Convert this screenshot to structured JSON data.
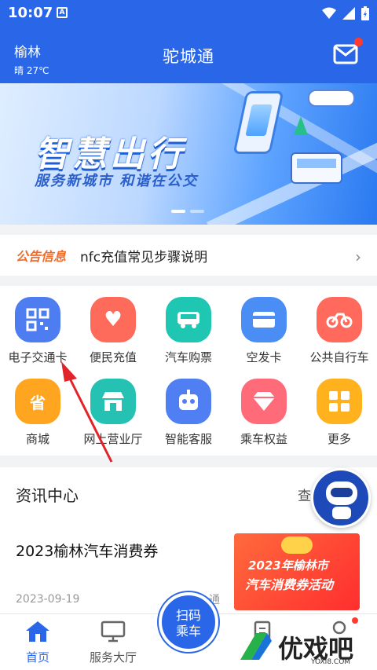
{
  "status_bar": {
    "time": "10:07",
    "badge": "A"
  },
  "header": {
    "city": "榆林",
    "weather": "晴 27℃",
    "title": "驼城通",
    "mail_icon": "mail-icon"
  },
  "banner": {
    "headline": "智慧出行",
    "subline": "服务新城市 和谐在公交"
  },
  "notice": {
    "tag": "公告信息",
    "text": "nfc充值常见步骤说明"
  },
  "services": [
    {
      "label": "电子交通卡",
      "icon": "qr-card-icon",
      "color": "#4d7df0"
    },
    {
      "label": "便民充值",
      "icon": "heart-hand-icon",
      "color": "#ff6b5a"
    },
    {
      "label": "汽车购票",
      "icon": "bus-icon",
      "color": "#1fc6b2"
    },
    {
      "label": "空发卡",
      "icon": "card-icon",
      "color": "#4a8ef5"
    },
    {
      "label": "公共自行车",
      "icon": "bike-icon",
      "color": "#ff6a5c"
    },
    {
      "label": "商城",
      "icon": "shop-bag-icon",
      "color": "#ffa51f"
    },
    {
      "label": "网上营业厅",
      "icon": "store-icon",
      "color": "#25c2b4"
    },
    {
      "label": "智能客服",
      "icon": "robot-icon",
      "color": "#4f7ff2"
    },
    {
      "label": "乘车权益",
      "icon": "diamond-icon",
      "color": "#ff6b78"
    },
    {
      "label": "更多",
      "icon": "grid-icon",
      "color": "#ffb21e"
    }
  ],
  "news": {
    "section_title": "资讯中心",
    "more": "查",
    "item_title": "2023榆林汽车消费券",
    "date": "2023-09-19",
    "read_fragment": "通",
    "thumb_line1": "2023年榆林市",
    "thumb_line2": "汽车消费券活动"
  },
  "bottom_nav": {
    "home": "首页",
    "service": "服务大厅",
    "scan_line1": "扫码",
    "scan_line2": "乘车"
  },
  "watermark": {
    "text": "优戏吧",
    "url": "YOXI8.COM"
  }
}
